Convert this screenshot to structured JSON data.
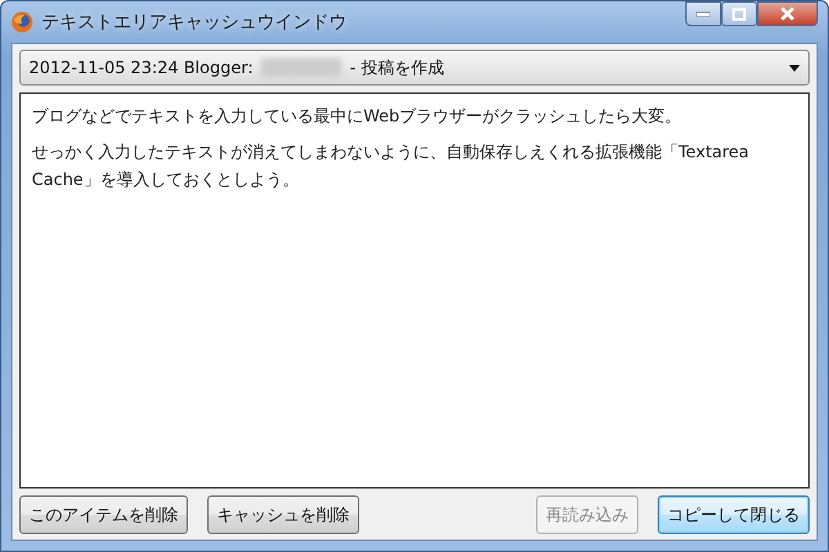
{
  "window": {
    "title": "テキストエリアキャッシュウインドウ"
  },
  "entry_select": {
    "value_prefix": "2012-11-05 23:24  Blogger:",
    "value_suffix": "- 投稿を作成",
    "redacted": true
  },
  "textarea": {
    "paragraphs": [
      "ブログなどでテキストを入力している最中にWebブラウザーがクラッシュしたら大変。",
      "せっかく入力したテキストが消えてしまわないように、自動保存しえくれる拡張機能「Textarea Cache」を導入しておくとしよう。"
    ]
  },
  "left_buttons": [
    {
      "label": "このアイテムを削除",
      "disabled": false,
      "focused": false
    },
    {
      "label": "キャッシュを削除",
      "disabled": false,
      "focused": false
    }
  ],
  "right_buttons": [
    {
      "label": "再読み込み",
      "disabled": true,
      "focused": false
    },
    {
      "label": "コピーして閉じる",
      "disabled": false,
      "focused": true
    }
  ]
}
